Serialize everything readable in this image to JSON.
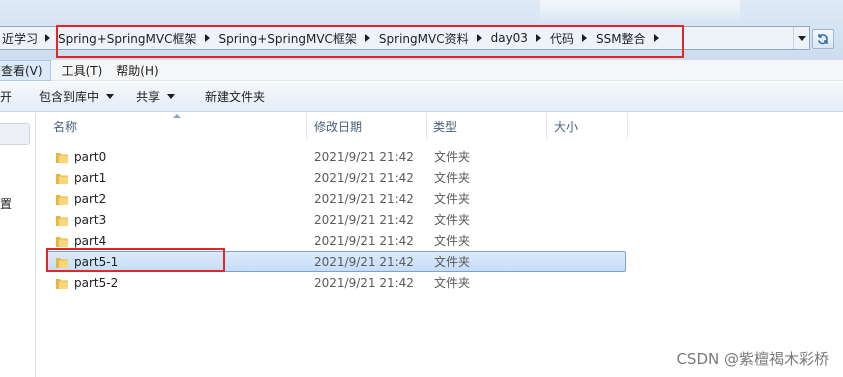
{
  "address_bar": {
    "partial_crumb": "近学习",
    "crumbs": [
      {
        "label": "Spring+SpringMVC框架"
      },
      {
        "label": "Spring+SpringMVC框架"
      },
      {
        "label": "SpringMVC资料"
      },
      {
        "label": "day03"
      },
      {
        "label": "代码"
      },
      {
        "label": "SSM整合"
      }
    ],
    "dropdown_icon": "chevron-down-icon",
    "refresh_icon": "refresh-icon"
  },
  "menubar": {
    "items": [
      {
        "label": "查看(V)",
        "active": true
      },
      {
        "label": "工具(T)"
      },
      {
        "label": "帮助(H)"
      }
    ]
  },
  "toolbar": {
    "items": [
      {
        "label": "开"
      },
      {
        "label": "包含到库中",
        "dropdown": true
      },
      {
        "label": "共享",
        "dropdown": true
      },
      {
        "label": "新建文件夹"
      }
    ]
  },
  "navpane": {
    "partial_text": "置"
  },
  "columns": {
    "name": "名称",
    "date": "修改日期",
    "type": "类型",
    "size": "大小"
  },
  "files": [
    {
      "name": "part0",
      "date": "2021/9/21 21:42",
      "type": "文件夹"
    },
    {
      "name": "part1",
      "date": "2021/9/21 21:42",
      "type": "文件夹"
    },
    {
      "name": "part2",
      "date": "2021/9/21 21:42",
      "type": "文件夹"
    },
    {
      "name": "part3",
      "date": "2021/9/21 21:42",
      "type": "文件夹"
    },
    {
      "name": "part4",
      "date": "2021/9/21 21:42",
      "type": "文件夹"
    },
    {
      "name": "part5-1",
      "date": "2021/9/21 21:42",
      "type": "文件夹",
      "selected": true
    },
    {
      "name": "part5-2",
      "date": "2021/9/21 21:42",
      "type": "文件夹"
    }
  ],
  "watermark": "CSDN @紫檀褐木彩桥",
  "colors": {
    "highlight_box": "#e32626",
    "selection": "#c6ddf7",
    "folder": "#f2c24a"
  }
}
